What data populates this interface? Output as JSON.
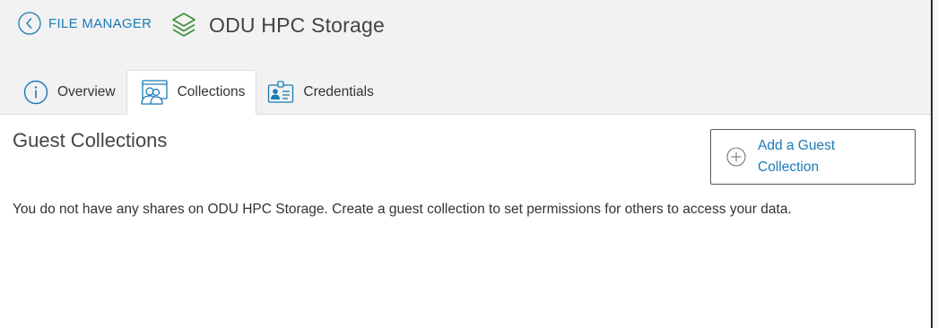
{
  "header": {
    "back_label": "FILE MANAGER",
    "endpoint_title": "ODU HPC Storage"
  },
  "tabs": [
    {
      "label": "Overview",
      "icon": "info-icon",
      "active": false
    },
    {
      "label": "Collections",
      "icon": "collections-icon",
      "active": true
    },
    {
      "label": "Credentials",
      "icon": "id-card-icon",
      "active": false
    }
  ],
  "main": {
    "section_title": "Guest Collections",
    "add_button_label": "Add a Guest Collection",
    "empty_message": "You do not have any shares on ODU HPC Storage. Create a guest collection to set permissions for others to access your data."
  },
  "colors": {
    "link": "#1a7bb5",
    "header_bg": "#f2f2f2",
    "layers_green": "#3a8f3a"
  }
}
